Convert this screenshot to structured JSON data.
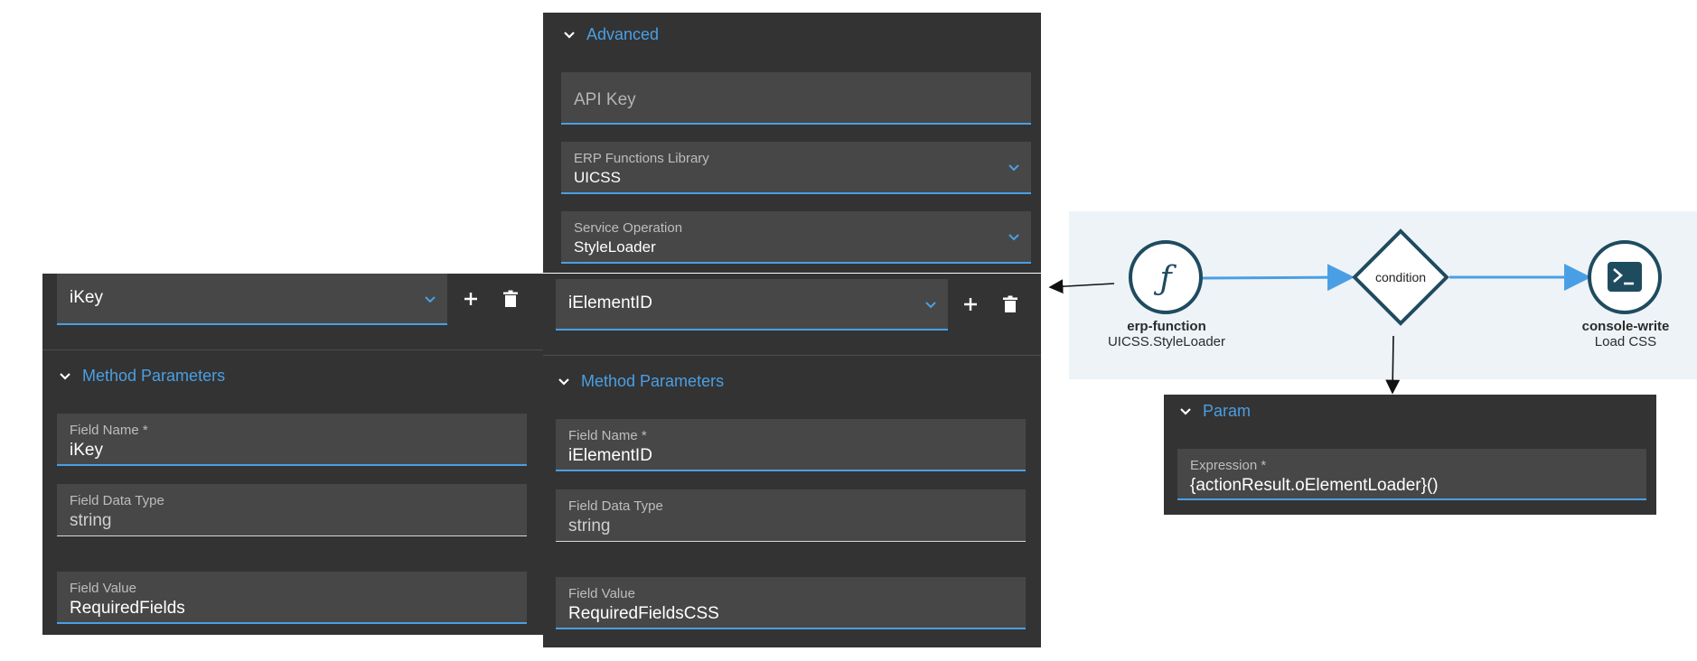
{
  "advanced_panel": {
    "header": "Advanced",
    "api_key_placeholder": "API Key",
    "erp_library": {
      "label": "ERP Functions Library",
      "value": "UICSS"
    },
    "service_operation": {
      "label": "Service Operation",
      "value": "StyleLoader"
    }
  },
  "left_param": {
    "selected": "iKey",
    "section": "Method Parameters",
    "field_name": {
      "label": "Field Name *",
      "value": "iKey"
    },
    "field_data_type": {
      "label": "Field Data Type",
      "value": "string"
    },
    "field_value": {
      "label": "Field Value",
      "value": "RequiredFields"
    }
  },
  "right_param": {
    "selected": "iElementID",
    "section": "Method Parameters",
    "field_name": {
      "label": "Field Name *",
      "value": "iElementID"
    },
    "field_data_type": {
      "label": "Field Data Type",
      "value": "string"
    },
    "field_value": {
      "label": "Field Value",
      "value": "RequiredFieldsCSS"
    }
  },
  "flow": {
    "erp_node": {
      "type": "erp-function",
      "subtitle": "UICSS.StyleLoader",
      "icon": "function-icon"
    },
    "condition_node": {
      "label": "condition"
    },
    "console_node": {
      "type": "console-write",
      "subtitle": "Load CSS",
      "icon": "terminal-icon"
    }
  },
  "param_panel": {
    "header": "Param",
    "expression": {
      "label": "Expression *",
      "value": "{actionResult.oElementLoader}()"
    }
  },
  "colors": {
    "accent": "#4a9fe4",
    "panel": "#333333",
    "field": "#474747",
    "node": "#1f4b5f"
  }
}
